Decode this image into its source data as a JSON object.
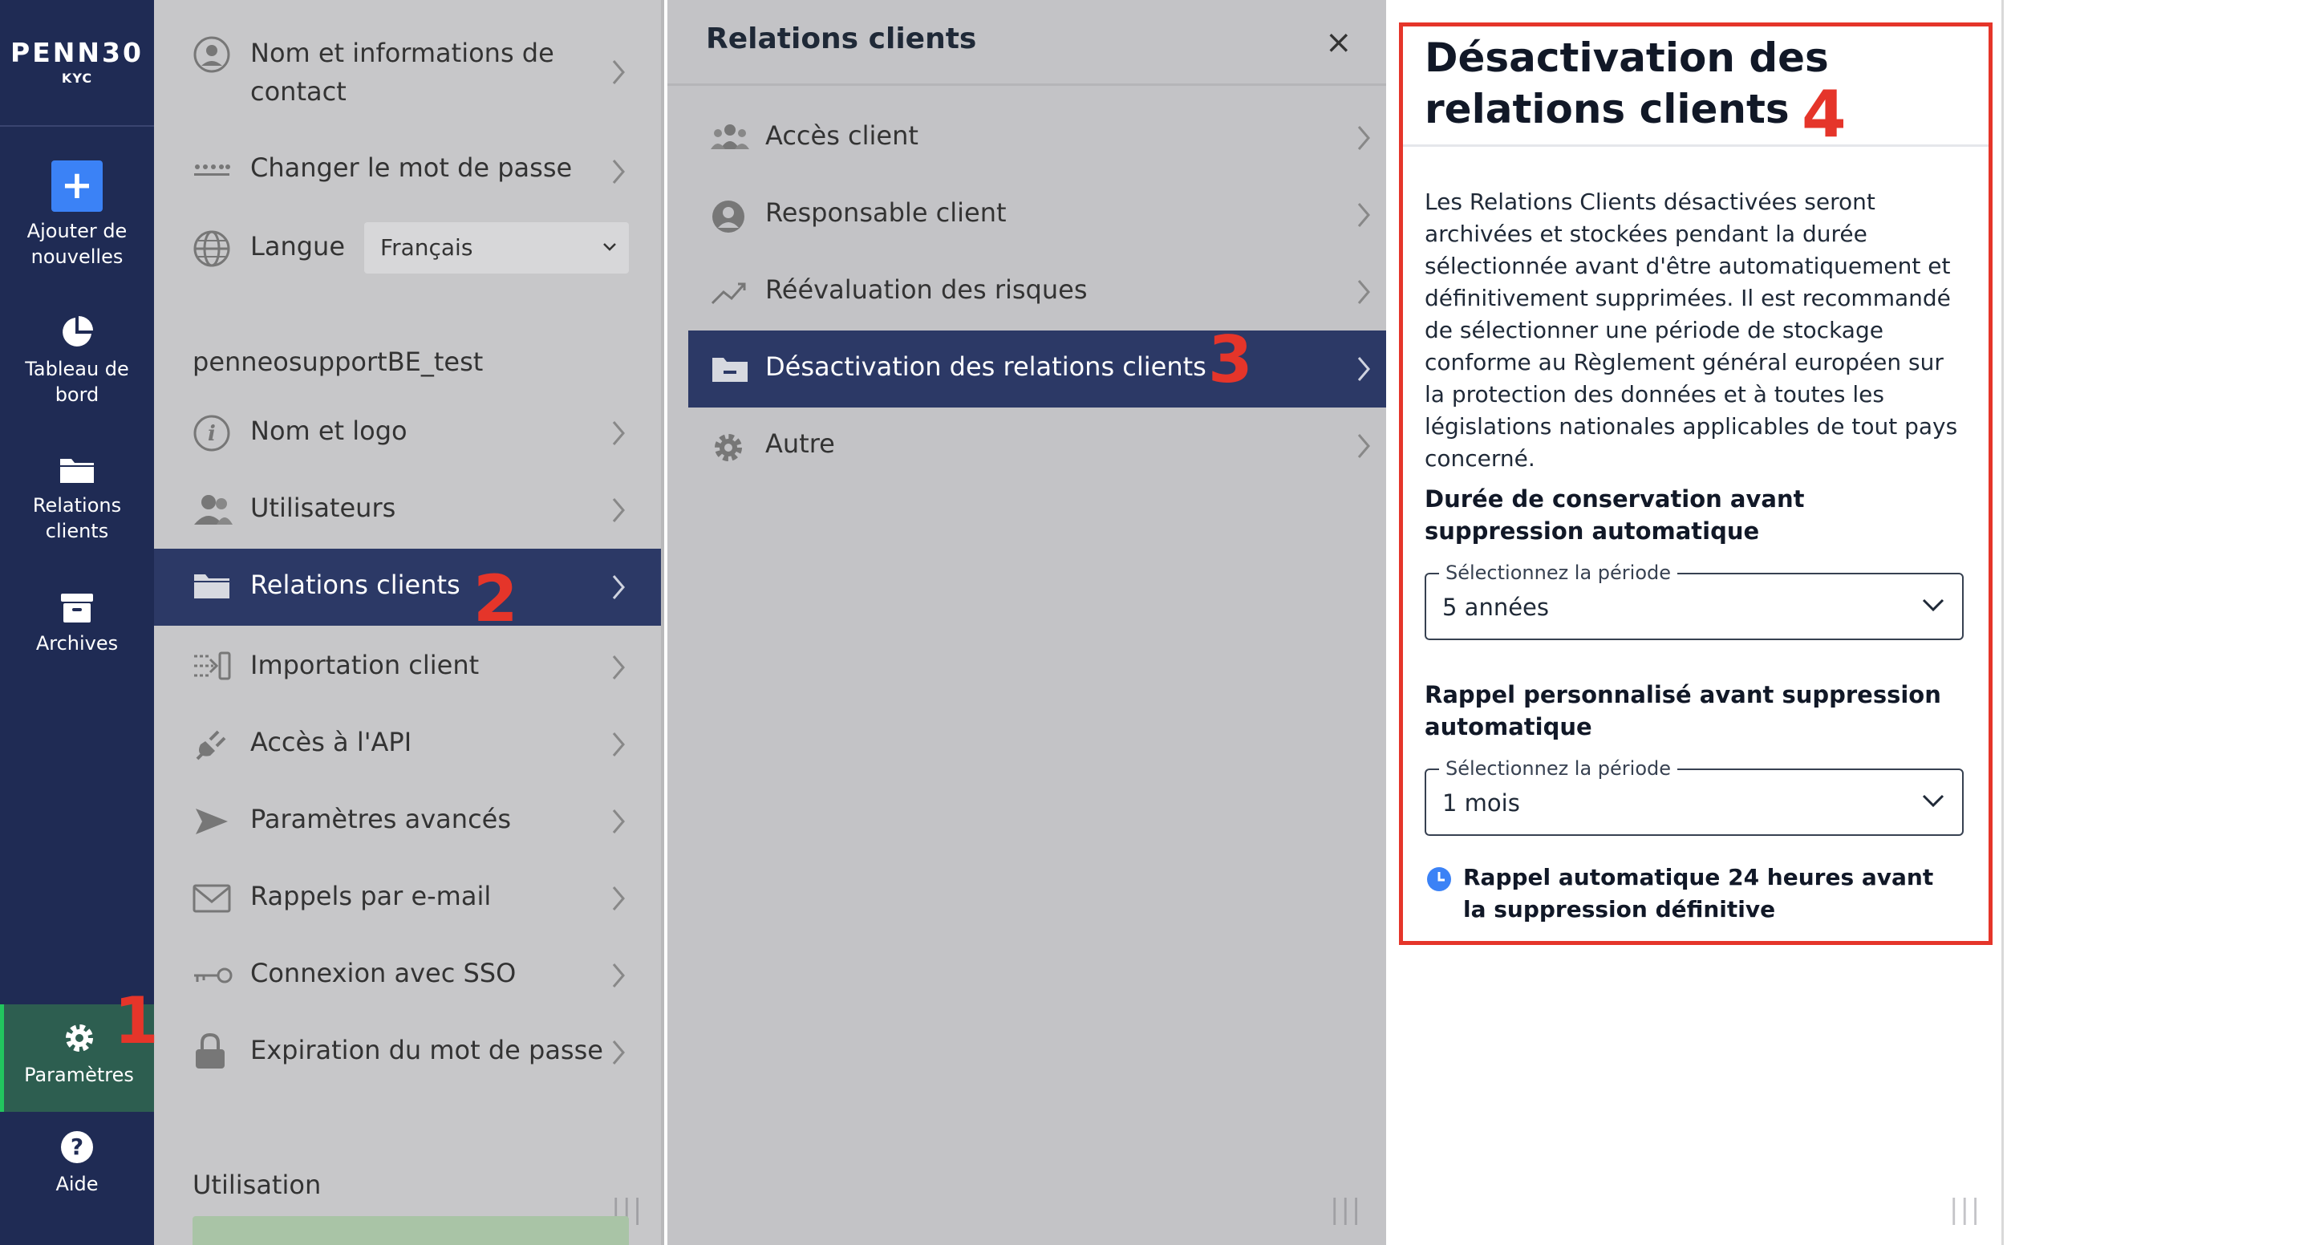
{
  "nav": {
    "logo": "PENN30",
    "logo_sub": "KYC",
    "items": [
      {
        "label": "Ajouter de nouvelles"
      },
      {
        "label": "Tableau de bord"
      },
      {
        "label": "Relations clients"
      },
      {
        "label": "Archives"
      },
      {
        "label": "Paramètres"
      },
      {
        "label": "Aide"
      }
    ]
  },
  "settings": {
    "items_top": [
      {
        "label": "Nom et informations de contact"
      },
      {
        "label": "Changer le mot de passe"
      }
    ],
    "language_label": "Langue",
    "language_value": "Français",
    "org_name": "penneosupportBE_test",
    "items_org": [
      {
        "label": "Nom et logo"
      },
      {
        "label": "Utilisateurs"
      },
      {
        "label": "Relations clients"
      },
      {
        "label": "Importation client"
      },
      {
        "label": "Accès à l'API"
      },
      {
        "label": "Paramètres avancés"
      },
      {
        "label": "Rappels par e-mail"
      },
      {
        "label": "Connexion avec SSO"
      },
      {
        "label": "Expiration du mot de passe"
      }
    ],
    "usage_heading": "Utilisation"
  },
  "client_relations": {
    "title": "Relations clients",
    "items": [
      {
        "label": "Accès client"
      },
      {
        "label": "Responsable client"
      },
      {
        "label": "Réévaluation des risques"
      },
      {
        "label": "Désactivation des relations clients"
      },
      {
        "label": "Autre"
      }
    ]
  },
  "deactivation": {
    "title": "Désactivation des relations clients",
    "description": "Les Relations Clients désactivées seront archivées et stockées pendant la durée sélectionnée avant d'être automatiquement et définitivement supprimées. Il est recommandé de sélectionner une période de stockage conforme au Règlement général européen sur la protection des données et à toutes les législations nationales applicables de tout pays concerné.",
    "retention_label": "Durée de conservation avant suppression automatique",
    "retention_legend": "Sélectionnez la période",
    "retention_value": "5 années",
    "reminder_label": "Rappel personnalisé avant suppression automatique",
    "reminder_legend": "Sélectionnez la période",
    "reminder_value": "1 mois",
    "auto_reminder": "Rappel automatique 24 heures avant la suppression définitive"
  },
  "annotations": [
    "1",
    "2",
    "3",
    "4"
  ],
  "colors": {
    "nav_bg": "#1f2b54",
    "active_row": "#2c3966",
    "annotation_red": "#e5352a",
    "clock_blue": "#3b82f6"
  }
}
